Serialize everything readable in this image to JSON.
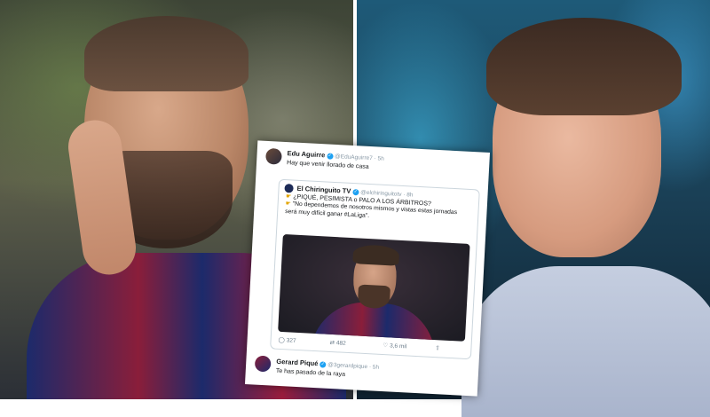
{
  "tweets": {
    "top": {
      "name": "Edu Aguirre",
      "handle": "@EduAguirre7 · 5h",
      "text": "Hay que venir llorado de casa"
    },
    "quoted": {
      "name": "El Chiringuito TV",
      "handle": "@elchiringuitotv · 8h",
      "headline": "¿PIQUÉ, PESIMISTA o PALO A LOS ÁRBITROS?",
      "body": "\"No dependemos de nosotros mismos y vistas estas jornadas será muy difícil ganar #LaLiga\".",
      "replies": "327",
      "retweets": "482",
      "likes": "3,6 mil"
    },
    "bottom": {
      "name": "Gerard Piqué",
      "handle": "@3gerardpique · 5h",
      "text": "Te has pasado de la raya"
    }
  },
  "colors": {
    "link_blue": "#1da1f2",
    "text_dark": "#14171a",
    "text_gray": "#8899a6"
  },
  "icons": [
    "verified-icon",
    "reply-icon",
    "retweet-icon",
    "like-icon",
    "share-icon",
    "pointing-hand-icon"
  ]
}
